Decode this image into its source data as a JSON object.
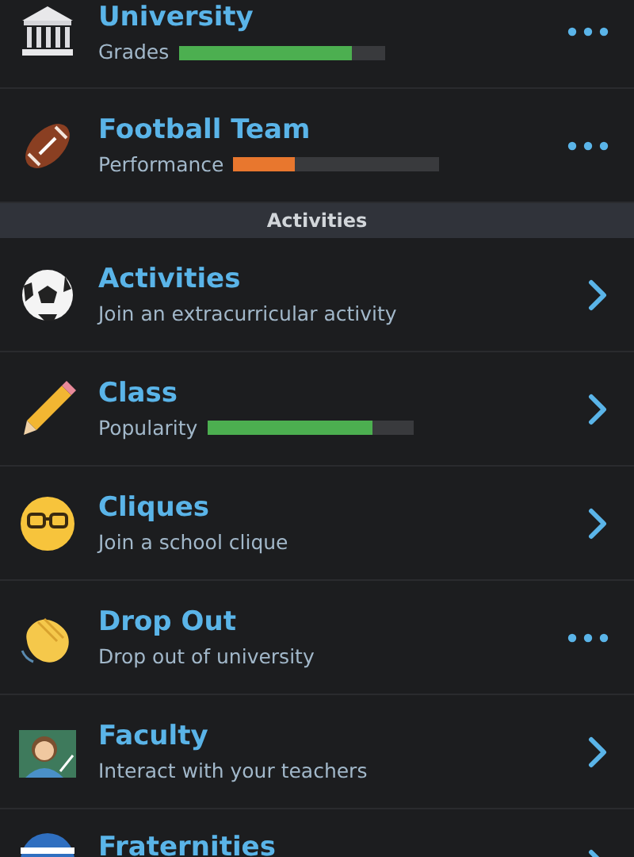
{
  "items": [
    {
      "kind": "row",
      "title": "University",
      "meter": {
        "label": "Grades",
        "level": 0.84,
        "color": "#4caf50"
      },
      "action": {
        "kind": "more"
      }
    },
    {
      "kind": "row",
      "title": "Football Team",
      "meter": {
        "label": "Performance",
        "level": 0.3,
        "color": "#e8772e"
      },
      "action": {
        "kind": "more"
      }
    },
    {
      "kind": "header",
      "title": "Activities"
    },
    {
      "kind": "row",
      "title": "Activities",
      "subtitle": "Join an extracurricular activity",
      "action": {
        "kind": "open"
      }
    },
    {
      "kind": "row",
      "title": "Class",
      "meter": {
        "label": "Popularity",
        "level": 0.8,
        "color": "#4caf50"
      },
      "action": {
        "kind": "open"
      }
    },
    {
      "kind": "row",
      "title": "Cliques",
      "subtitle": "Join a school clique",
      "action": {
        "kind": "open"
      }
    },
    {
      "kind": "row",
      "title": "Drop Out",
      "subtitle": "Drop out of university",
      "action": {
        "kind": "more"
      }
    },
    {
      "kind": "row",
      "title": "Faculty",
      "subtitle": "Interact with your teachers",
      "action": {
        "kind": "open"
      }
    },
    {
      "kind": "row",
      "title": "Fraternities",
      "action": {
        "kind": "open"
      }
    }
  ]
}
